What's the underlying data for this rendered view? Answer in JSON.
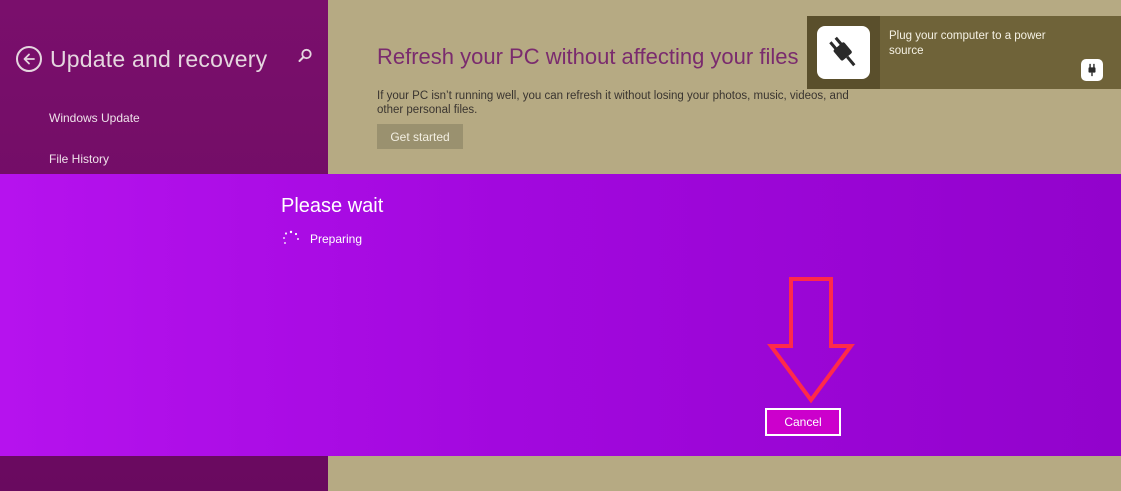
{
  "sidebar": {
    "title": "Update and recovery",
    "back_icon": "back-arrow-icon",
    "search_icon": "search-icon",
    "items": [
      {
        "label": "Windows Update"
      },
      {
        "label": "File History"
      }
    ]
  },
  "main": {
    "title": "Refresh your PC without affecting your files",
    "description": "If your PC isn’t running well, you can refresh it without losing your photos, music, videos, and other personal files.",
    "get_started_label": "Get started"
  },
  "toast": {
    "message": "Plug your computer to a power source",
    "icon": "power-plug-icon"
  },
  "wait_dialog": {
    "title": "Please wait",
    "status": "Preparing",
    "cancel_label": "Cancel"
  },
  "colors": {
    "sidebar": "#7a0f6c",
    "content_background": "#b6aa83",
    "wait_band": "#a208de",
    "cancel_button": "#cc00cc",
    "annotation_arrow": "#ff2a4a"
  }
}
